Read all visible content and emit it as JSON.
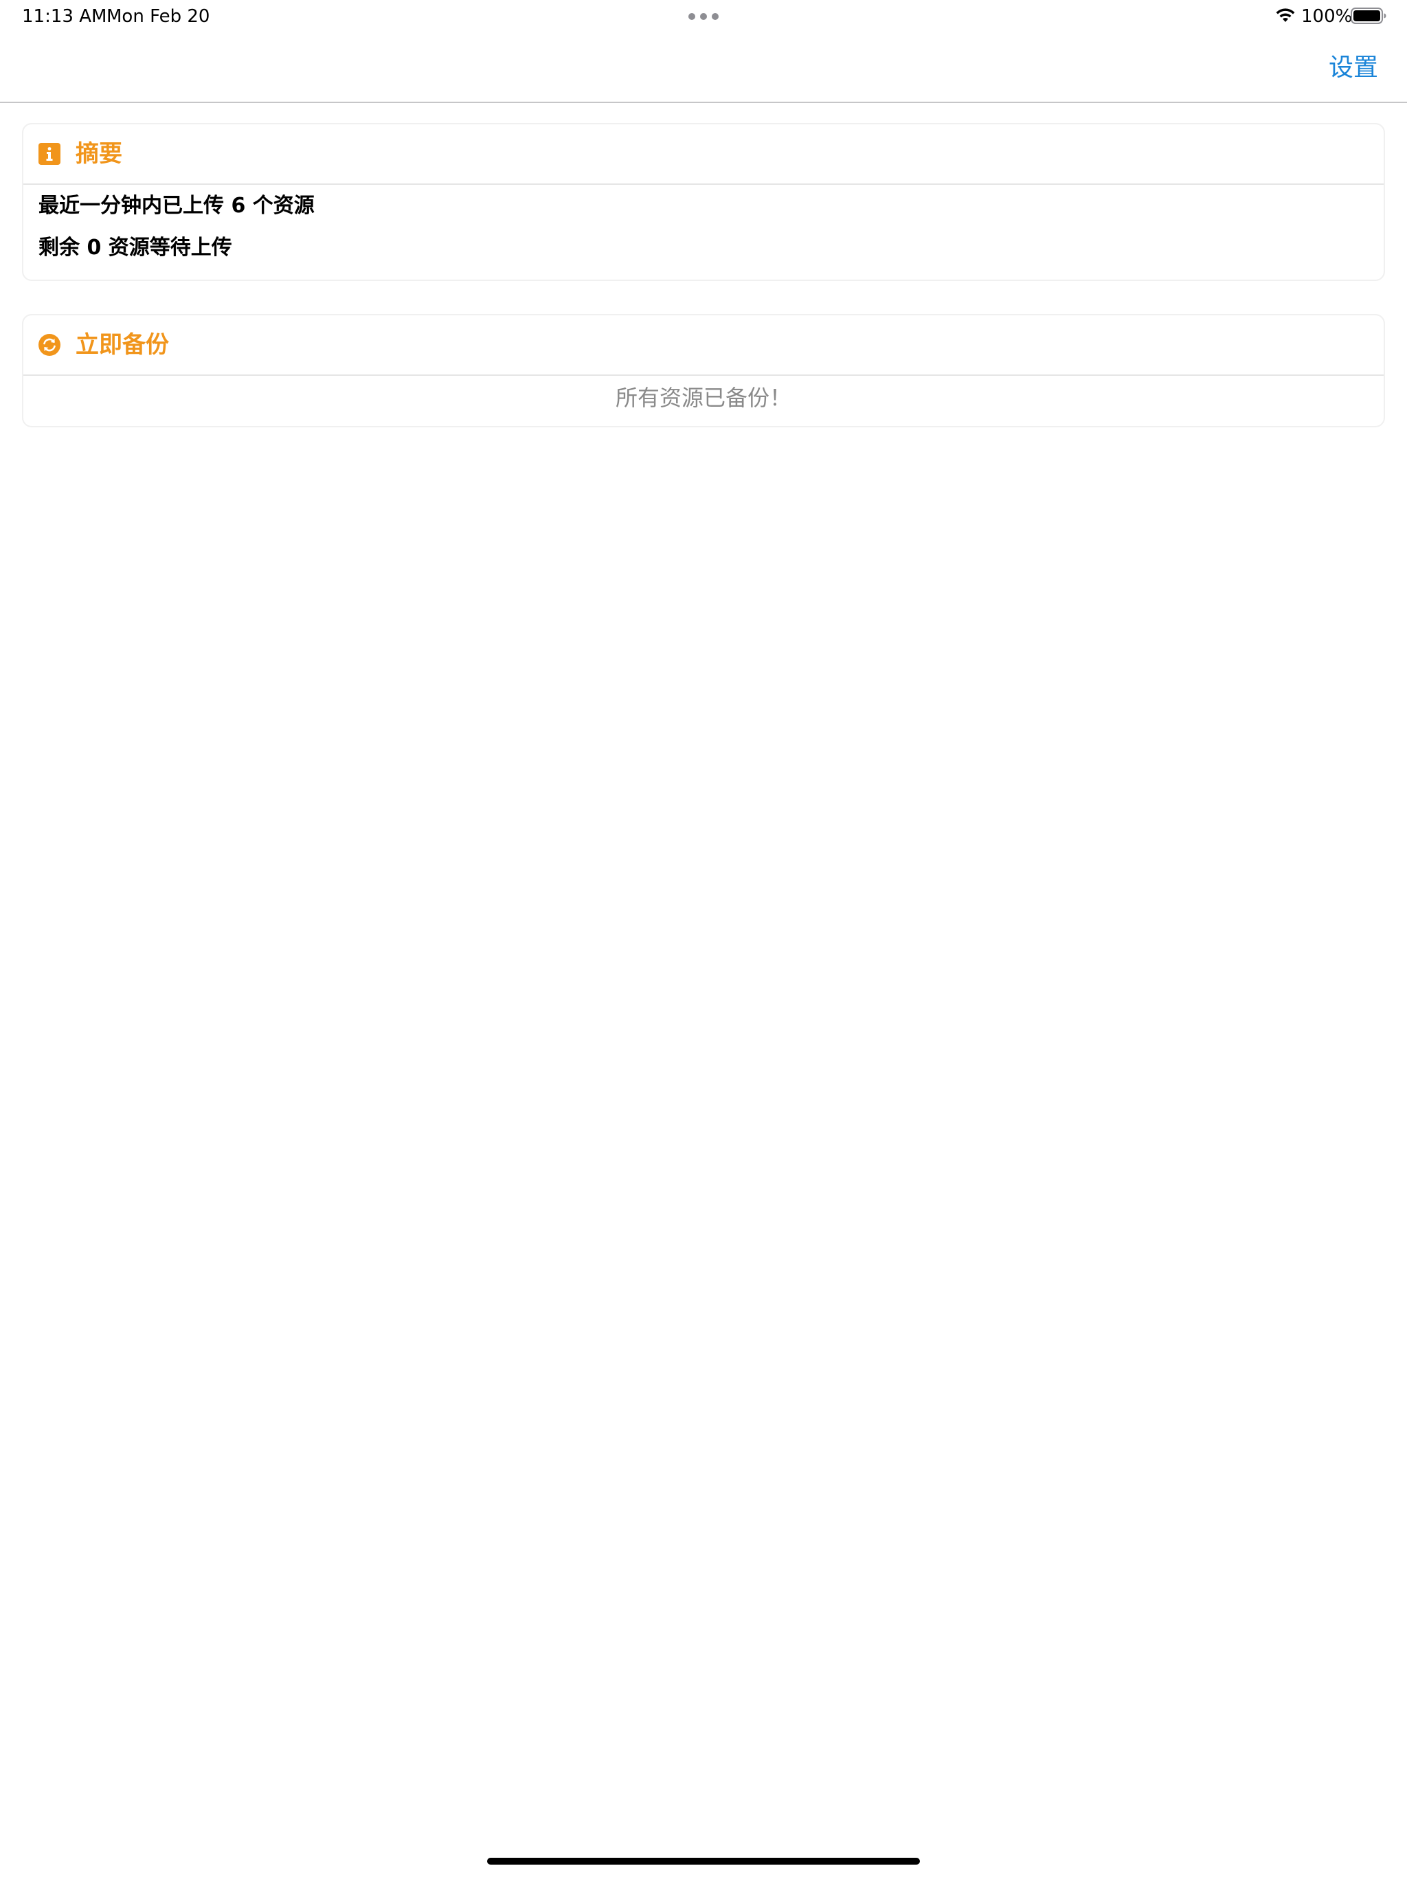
{
  "status_bar": {
    "time": "11:13 AM",
    "date": "Mon Feb 20",
    "battery": "100%",
    "icons": [
      "multitask-dots-icon",
      "wifi-icon",
      "battery-icon"
    ]
  },
  "nav": {
    "settings_label": "设置",
    "settings_color": "#1a84d8"
  },
  "summary": {
    "icon": "info-icon",
    "title": "摘要",
    "line1": "最近一分钟内已上传 6 个资源",
    "line2": "剩余 0 资源等待上传"
  },
  "backup": {
    "icon": "sync-icon",
    "title": "立即备份",
    "message": "所有资源已备份！"
  },
  "colors": {
    "accent": "#f1951b",
    "link": "#1a84d8",
    "muted_text": "#8a8a8a"
  }
}
